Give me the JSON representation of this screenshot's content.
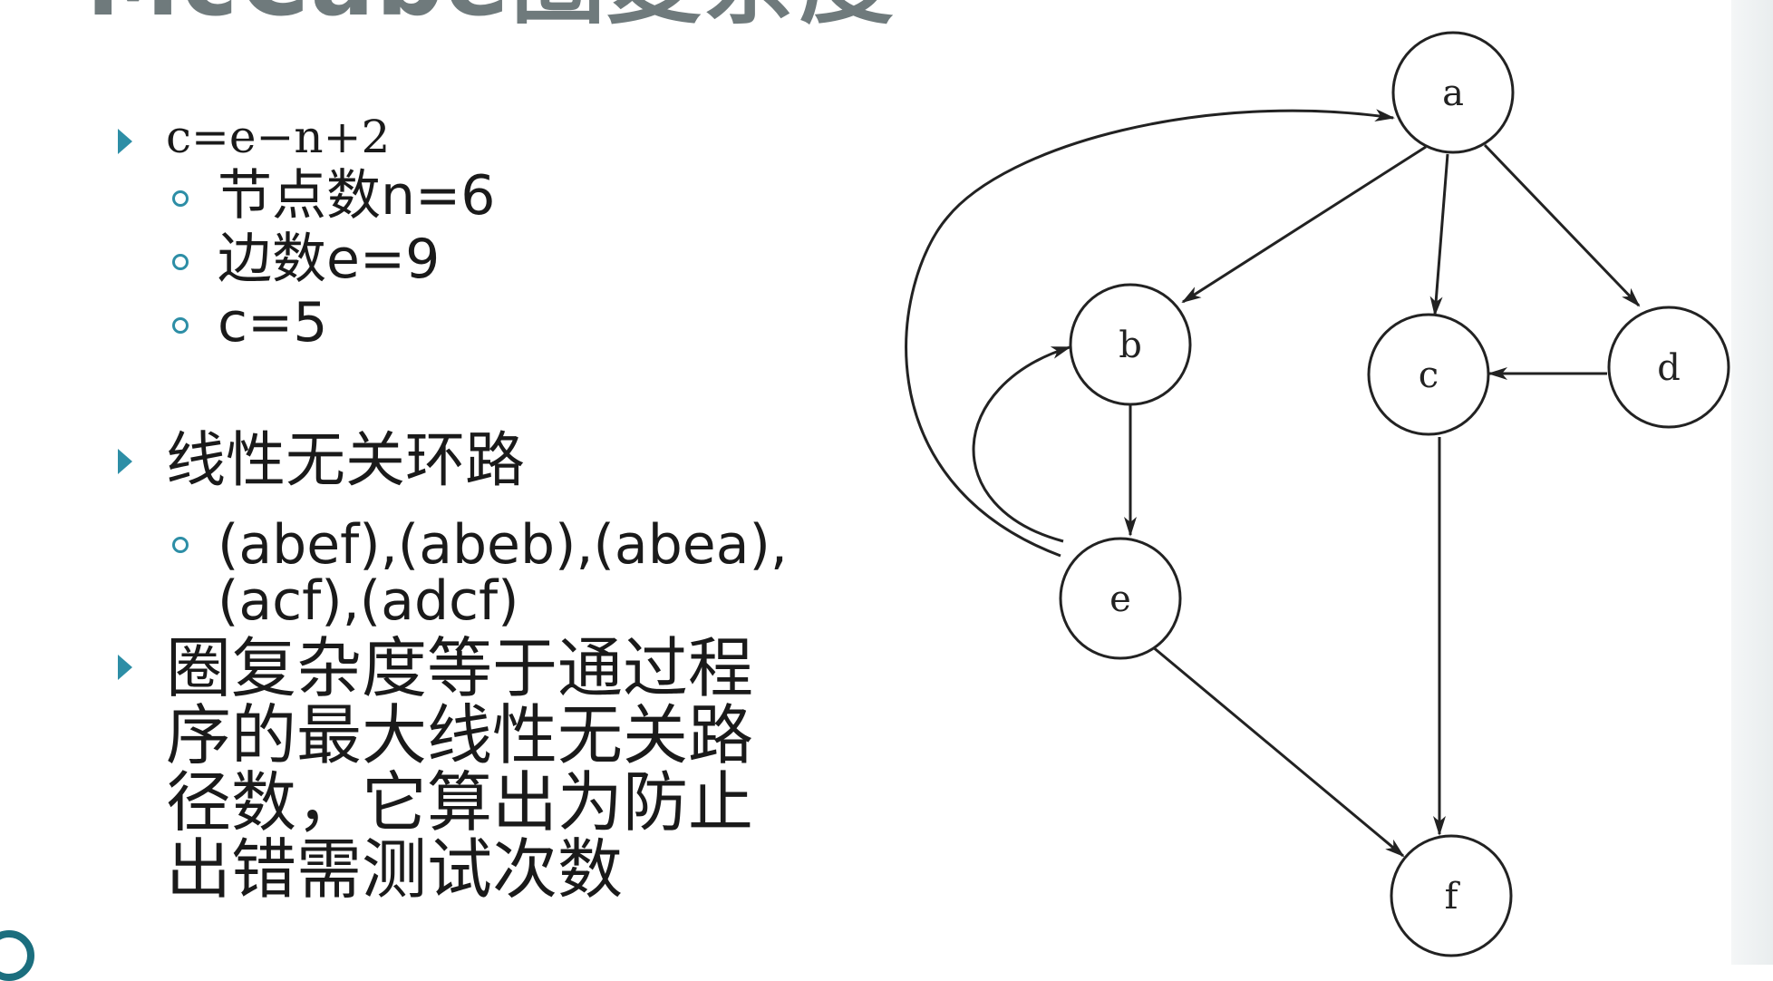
{
  "slide": {
    "title_fragment": "McCabe圈复杂度"
  },
  "formula": {
    "text": "c=e−n+2",
    "items": [
      "节点数n=6",
      "边数e=9",
      "c=5"
    ]
  },
  "independent_paths": {
    "heading": "线性无关环路",
    "paths_text": "(abef),(abeb),(abea),(acf),(adcf)"
  },
  "statement": {
    "text": "圈复杂度等于通过程序的最大线性无关路径数，它算出为防止出错需测试次数"
  },
  "graph": {
    "nodes": [
      {
        "id": "a",
        "label": "a"
      },
      {
        "id": "b",
        "label": "b"
      },
      {
        "id": "c",
        "label": "c"
      },
      {
        "id": "d",
        "label": "d"
      },
      {
        "id": "e",
        "label": "e"
      },
      {
        "id": "f",
        "label": "f"
      }
    ],
    "edges": [
      {
        "from": "a",
        "to": "b"
      },
      {
        "from": "a",
        "to": "c"
      },
      {
        "from": "a",
        "to": "d"
      },
      {
        "from": "d",
        "to": "c"
      },
      {
        "from": "b",
        "to": "e"
      },
      {
        "from": "e",
        "to": "b"
      },
      {
        "from": "e",
        "to": "a"
      },
      {
        "from": "c",
        "to": "f"
      },
      {
        "from": "e",
        "to": "f"
      }
    ]
  },
  "colors": {
    "accent": "#2d8ea6",
    "title_gray": "#6f7a7c",
    "dark_teal": "#1b6e7e"
  }
}
